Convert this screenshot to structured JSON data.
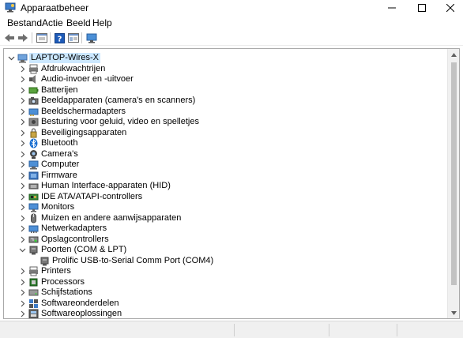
{
  "window": {
    "title": "Apparaatbeheer",
    "icon": "device-manager-icon"
  },
  "menu": {
    "items": [
      "Bestand",
      "Actie",
      "Beeld",
      "Help"
    ]
  },
  "toolbar": {
    "buttons": [
      "back-arrow-icon",
      "forward-arrow-icon",
      "properties-icon",
      "help-icon",
      "view-icon",
      "monitor-icon"
    ]
  },
  "tree": {
    "root": "LAPTOP-Wires-X",
    "items": [
      {
        "label": "Afdrukwachtrijen",
        "icon": "print-queue-icon",
        "expanded": false
      },
      {
        "label": "Audio-invoer en -uitvoer",
        "icon": "speaker-icon",
        "expanded": false
      },
      {
        "label": "Batterijen",
        "icon": "battery-icon",
        "expanded": false
      },
      {
        "label": "Beeldapparaten (camera's en scanners)",
        "icon": "camera-scanner-icon",
        "expanded": false
      },
      {
        "label": "Beeldschermadapters",
        "icon": "display-adapter-icon",
        "expanded": false
      },
      {
        "label": "Besturing voor geluid, video en spelletjes",
        "icon": "sound-icon",
        "expanded": false
      },
      {
        "label": "Beveiligingsapparaten",
        "icon": "security-key-icon",
        "expanded": false
      },
      {
        "label": "Bluetooth",
        "icon": "bluetooth-icon",
        "expanded": false
      },
      {
        "label": "Camera's",
        "icon": "webcam-icon",
        "expanded": false
      },
      {
        "label": "Computer",
        "icon": "computer-icon",
        "expanded": false
      },
      {
        "label": "Firmware",
        "icon": "firmware-icon",
        "expanded": false
      },
      {
        "label": "Human Interface-apparaten (HID)",
        "icon": "hid-icon",
        "expanded": false
      },
      {
        "label": "IDE ATA/ATAPI-controllers",
        "icon": "ide-controller-icon",
        "expanded": false
      },
      {
        "label": "Monitors",
        "icon": "monitor-icon",
        "expanded": false
      },
      {
        "label": "Muizen en andere aanwijsapparaten",
        "icon": "mouse-icon",
        "expanded": false
      },
      {
        "label": "Netwerkadapters",
        "icon": "network-adapter-icon",
        "expanded": false
      },
      {
        "label": "Opslagcontrollers",
        "icon": "storage-controller-icon",
        "expanded": false
      },
      {
        "label": "Poorten (COM & LPT)",
        "icon": "port-icon",
        "expanded": true,
        "children": [
          {
            "label": "Prolific USB-to-Serial Comm Port (COM4)",
            "icon": "port-icon"
          }
        ]
      },
      {
        "label": "Printers",
        "icon": "printer-icon",
        "expanded": false
      },
      {
        "label": "Processors",
        "icon": "processor-icon",
        "expanded": false
      },
      {
        "label": "Schijfstations",
        "icon": "disk-drive-icon",
        "expanded": false
      },
      {
        "label": "Softwareonderdelen",
        "icon": "software-component-icon",
        "expanded": false
      },
      {
        "label": "Softwareoplossingen",
        "icon": "software-solution-icon",
        "expanded": false
      }
    ]
  },
  "colors": {
    "selection": "#cce8ff",
    "accent": "#0078d7"
  }
}
